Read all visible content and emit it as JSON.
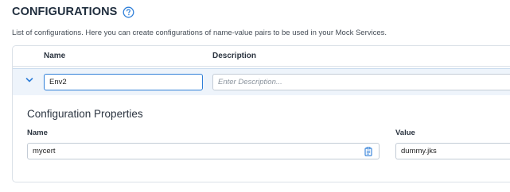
{
  "header": {
    "title": "CONFIGURATIONS",
    "help_icon": "help-circle-icon",
    "description": "List of configurations. Here you can create configurations of name-value pairs to be used in your Mock Services."
  },
  "table": {
    "columns": [
      "Name",
      "Description"
    ],
    "row": {
      "expand_icon": "chevron-down-icon",
      "name_value": "Env2",
      "description_value": "",
      "description_placeholder": "Enter Description..."
    }
  },
  "properties": {
    "title": "Configuration Properties",
    "name_label": "Name",
    "value_label": "Value",
    "items": [
      {
        "name": "mycert",
        "value": "dummy.jks",
        "icon": "clipboard-icon"
      }
    ]
  },
  "colors": {
    "accent": "#2f7fd8",
    "row_highlight": "#eef4fb",
    "border": "#dbe1e8"
  }
}
